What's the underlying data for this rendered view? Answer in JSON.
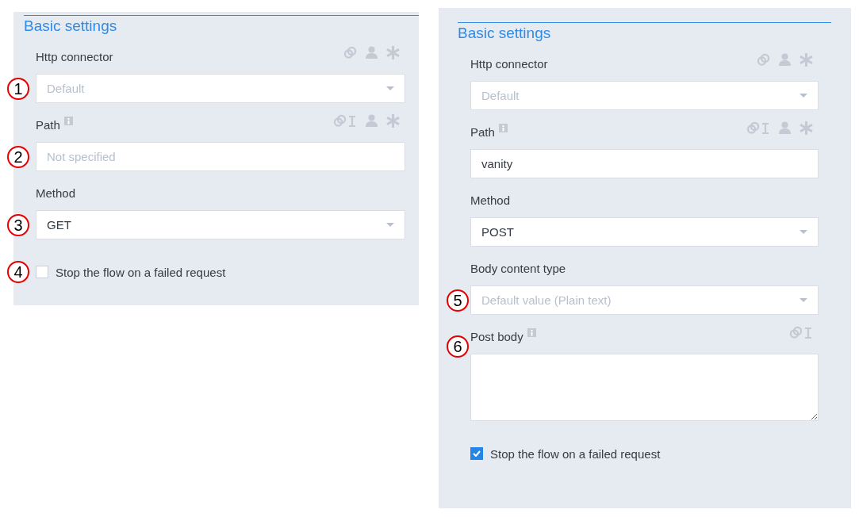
{
  "panels": [
    {
      "title": "Basic settings",
      "fields": [
        {
          "label": "Http connector",
          "info": false,
          "icons": [
            {
              "kind": "link"
            },
            {
              "kind": "user"
            },
            {
              "kind": "asterisk"
            }
          ],
          "kind": "select",
          "placeholder": "Default",
          "callout": "1"
        },
        {
          "label": "Path",
          "info": true,
          "icons": [
            {
              "kind": "link-text"
            },
            {
              "kind": "user"
            },
            {
              "kind": "asterisk"
            }
          ],
          "kind": "input",
          "placeholder": "Not specified",
          "callout": "2"
        },
        {
          "label": "Method",
          "info": false,
          "kind": "select",
          "value": "GET",
          "callout": "3"
        }
      ],
      "checkbox": {
        "label": "Stop the flow on a failed request",
        "checked": false,
        "callout": "4"
      }
    },
    {
      "title": "Basic settings",
      "fields": [
        {
          "label": "Http connector",
          "info": false,
          "icons": [
            {
              "kind": "link"
            },
            {
              "kind": "user"
            },
            {
              "kind": "asterisk"
            }
          ],
          "kind": "select",
          "placeholder": "Default"
        },
        {
          "label": "Path",
          "info": true,
          "icons": [
            {
              "kind": "link-text"
            },
            {
              "kind": "user"
            },
            {
              "kind": "asterisk"
            }
          ],
          "kind": "input",
          "value": "vanity"
        },
        {
          "label": "Method",
          "info": false,
          "kind": "select",
          "value": "POST"
        },
        {
          "label": "Body content type",
          "info": false,
          "kind": "select",
          "placeholder": "Default value (Plain text)",
          "callout": "5"
        },
        {
          "label": "Post body",
          "info": true,
          "icons": [
            {
              "kind": "link-text"
            }
          ],
          "kind": "textarea",
          "callout": "6"
        }
      ],
      "checkbox": {
        "label": "Stop the flow on a failed request",
        "checked": true
      }
    }
  ]
}
